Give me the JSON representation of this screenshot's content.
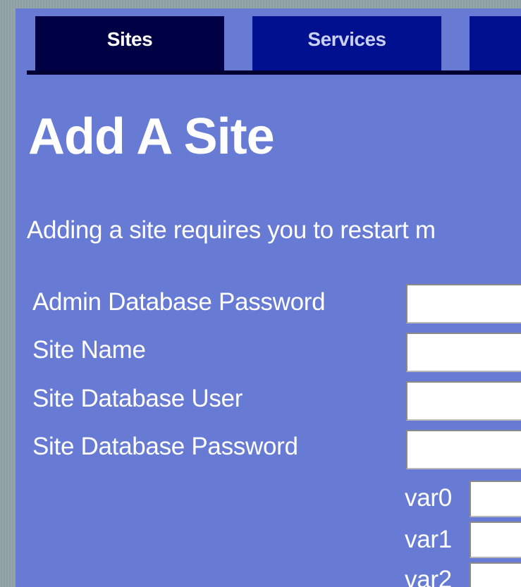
{
  "tabs": [
    {
      "label": "Sites",
      "active": true
    },
    {
      "label": "Services",
      "active": false
    },
    {
      "label": "",
      "active": false
    }
  ],
  "page": {
    "title": "Add A Site",
    "notice": "Adding a site requires you to restart m"
  },
  "form": {
    "fields": [
      {
        "label": "Admin Database Password",
        "value": ""
      },
      {
        "label": "Site Name",
        "value": ""
      },
      {
        "label": "Site Database User",
        "value": ""
      },
      {
        "label": "Site Database Password",
        "value": ""
      }
    ],
    "vars": [
      {
        "label": "var0",
        "value": ""
      },
      {
        "label": "var1",
        "value": ""
      },
      {
        "label": "var2",
        "value": ""
      }
    ]
  },
  "colors": {
    "panel_bg": "#687bd4",
    "tab_active_bg": "#000044",
    "tab_bg": "#00108f",
    "tab_rule": "#000033"
  }
}
